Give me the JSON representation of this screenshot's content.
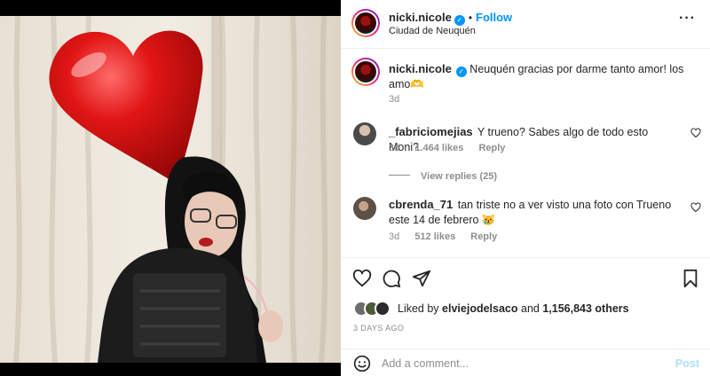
{
  "post": {
    "username": "nicki.nicole",
    "follow_label": "Follow",
    "location": "Ciudad de Neuquén",
    "more_icon": "more-horizontal-icon",
    "caption": {
      "username": "nicki.nicole",
      "text": "Neuquén gracias por darme tanto amor! los amo🫶",
      "age": "3d"
    }
  },
  "comments": [
    {
      "username": "_fabriciomejias",
      "text": "Y trueno? Sabes algo de todo esto Moni?",
      "age": "3d",
      "likes": "1.464 likes",
      "reply_label": "Reply",
      "view_replies": "View replies (25)"
    },
    {
      "username": "cbrenda_71",
      "text": "tan triste no a ver visto una foto con Trueno este 14 de febrero 😿",
      "age": "3d",
      "likes": "512 likes",
      "reply_label": "Reply"
    }
  ],
  "likes": {
    "prefix": "Liked by",
    "user": "elviejodelsaco",
    "conjunction": "and",
    "others": "1,156,843 others"
  },
  "date": "3 DAYS AGO",
  "add_comment": {
    "placeholder": "Add a comment...",
    "post_label": "Post"
  },
  "colors": {
    "accent": "#0095f6",
    "post_disabled": "#b2dffc",
    "muted": "#8e8e8e"
  }
}
